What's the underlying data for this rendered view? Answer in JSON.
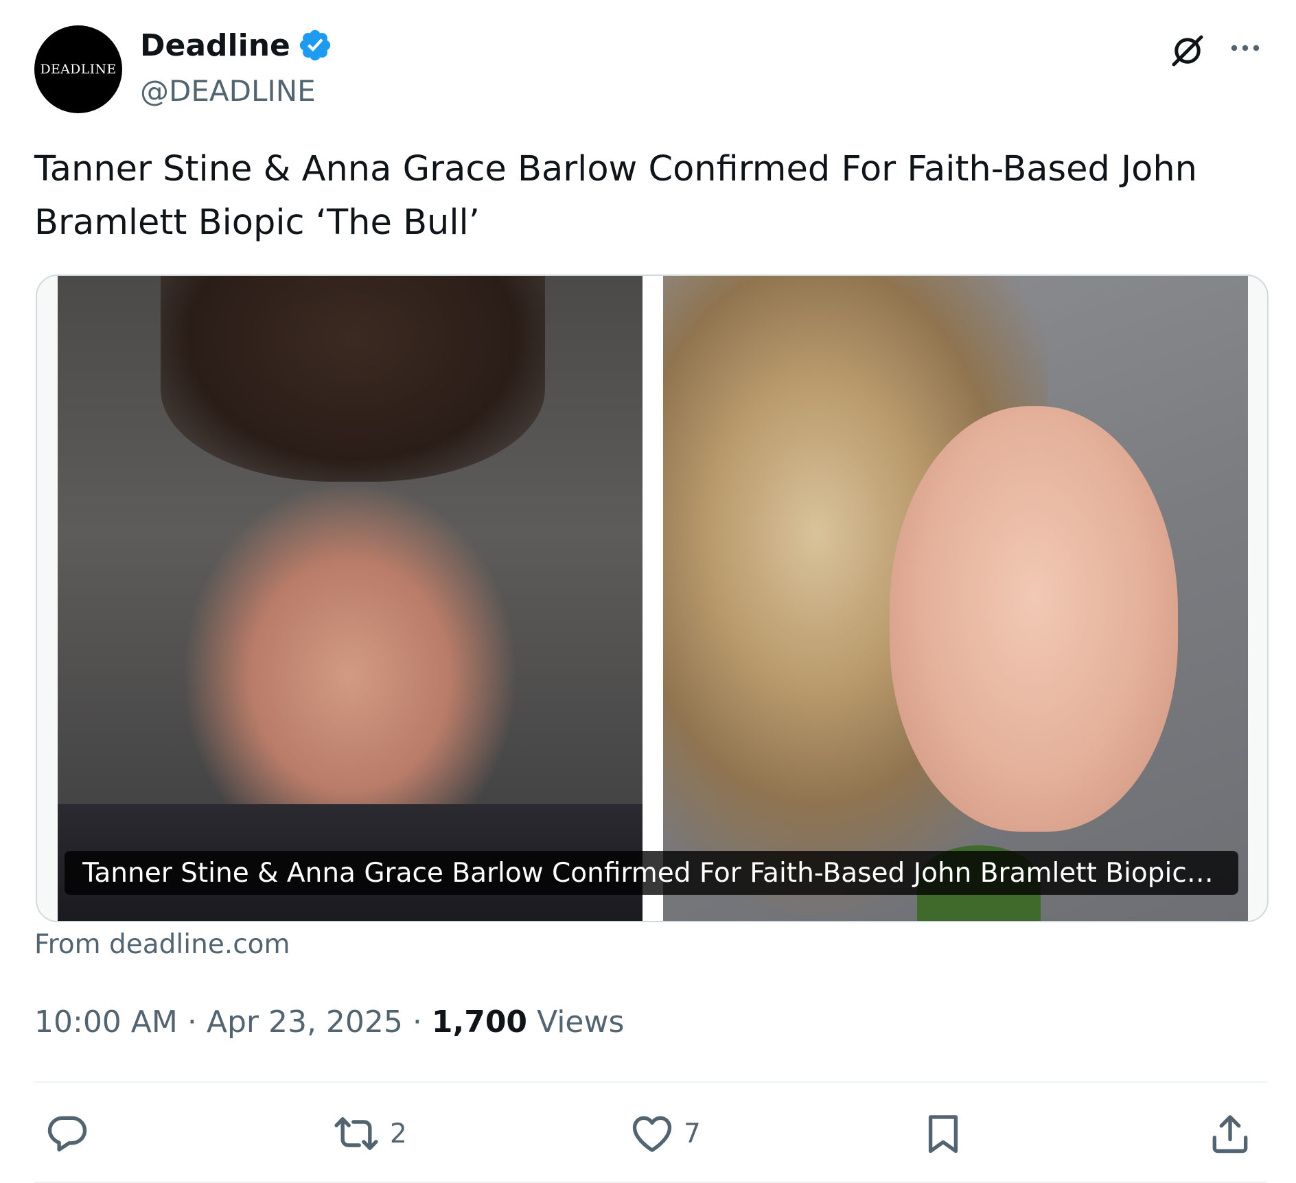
{
  "author": {
    "avatar_text": "DEADLINE",
    "display_name": "Deadline",
    "handle": "@DEADLINE",
    "verified": true
  },
  "post": {
    "text": "Tanner Stine & Anna Grace Barlow Confirmed For Faith-Based John Bramlett Biopic ‘The Bull’",
    "card_caption": "Tanner Stine & Anna Grace Barlow Confirmed For Faith-Based John Bramlett Biopic ‘T...",
    "source": "From deadline.com",
    "time": "10:00 AM",
    "date": "Apr 23, 2025",
    "views_count": "1,700",
    "views_label": "Views"
  },
  "actions": {
    "reply_count": "",
    "retweet_count": "2",
    "like_count": "7",
    "bookmark_count": "",
    "share_count": ""
  },
  "icons": {
    "verified": "verified-badge-icon",
    "grok": "grok-icon",
    "more": "more-icon",
    "reply": "reply-icon",
    "retweet": "retweet-icon",
    "like": "heart-icon",
    "bookmark": "bookmark-icon",
    "share": "share-icon"
  },
  "colors": {
    "text_primary": "#0f1419",
    "text_secondary": "#536471",
    "verified_blue": "#1d9bf0",
    "border": "#cfd9de"
  }
}
